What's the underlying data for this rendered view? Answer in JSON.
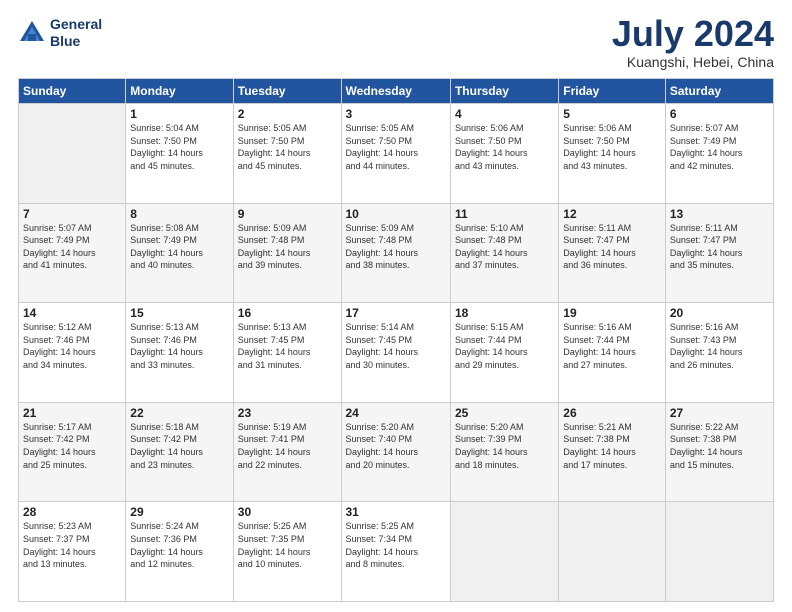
{
  "header": {
    "logo_line1": "General",
    "logo_line2": "Blue",
    "title": "July 2024",
    "location": "Kuangshi, Hebei, China"
  },
  "weekdays": [
    "Sunday",
    "Monday",
    "Tuesday",
    "Wednesday",
    "Thursday",
    "Friday",
    "Saturday"
  ],
  "weeks": [
    [
      {
        "day": "",
        "info": ""
      },
      {
        "day": "1",
        "info": "Sunrise: 5:04 AM\nSunset: 7:50 PM\nDaylight: 14 hours\nand 45 minutes."
      },
      {
        "day": "2",
        "info": "Sunrise: 5:05 AM\nSunset: 7:50 PM\nDaylight: 14 hours\nand 45 minutes."
      },
      {
        "day": "3",
        "info": "Sunrise: 5:05 AM\nSunset: 7:50 PM\nDaylight: 14 hours\nand 44 minutes."
      },
      {
        "day": "4",
        "info": "Sunrise: 5:06 AM\nSunset: 7:50 PM\nDaylight: 14 hours\nand 43 minutes."
      },
      {
        "day": "5",
        "info": "Sunrise: 5:06 AM\nSunset: 7:50 PM\nDaylight: 14 hours\nand 43 minutes."
      },
      {
        "day": "6",
        "info": "Sunrise: 5:07 AM\nSunset: 7:49 PM\nDaylight: 14 hours\nand 42 minutes."
      }
    ],
    [
      {
        "day": "7",
        "info": "Sunrise: 5:07 AM\nSunset: 7:49 PM\nDaylight: 14 hours\nand 41 minutes."
      },
      {
        "day": "8",
        "info": "Sunrise: 5:08 AM\nSunset: 7:49 PM\nDaylight: 14 hours\nand 40 minutes."
      },
      {
        "day": "9",
        "info": "Sunrise: 5:09 AM\nSunset: 7:48 PM\nDaylight: 14 hours\nand 39 minutes."
      },
      {
        "day": "10",
        "info": "Sunrise: 5:09 AM\nSunset: 7:48 PM\nDaylight: 14 hours\nand 38 minutes."
      },
      {
        "day": "11",
        "info": "Sunrise: 5:10 AM\nSunset: 7:48 PM\nDaylight: 14 hours\nand 37 minutes."
      },
      {
        "day": "12",
        "info": "Sunrise: 5:11 AM\nSunset: 7:47 PM\nDaylight: 14 hours\nand 36 minutes."
      },
      {
        "day": "13",
        "info": "Sunrise: 5:11 AM\nSunset: 7:47 PM\nDaylight: 14 hours\nand 35 minutes."
      }
    ],
    [
      {
        "day": "14",
        "info": "Sunrise: 5:12 AM\nSunset: 7:46 PM\nDaylight: 14 hours\nand 34 minutes."
      },
      {
        "day": "15",
        "info": "Sunrise: 5:13 AM\nSunset: 7:46 PM\nDaylight: 14 hours\nand 33 minutes."
      },
      {
        "day": "16",
        "info": "Sunrise: 5:13 AM\nSunset: 7:45 PM\nDaylight: 14 hours\nand 31 minutes."
      },
      {
        "day": "17",
        "info": "Sunrise: 5:14 AM\nSunset: 7:45 PM\nDaylight: 14 hours\nand 30 minutes."
      },
      {
        "day": "18",
        "info": "Sunrise: 5:15 AM\nSunset: 7:44 PM\nDaylight: 14 hours\nand 29 minutes."
      },
      {
        "day": "19",
        "info": "Sunrise: 5:16 AM\nSunset: 7:44 PM\nDaylight: 14 hours\nand 27 minutes."
      },
      {
        "day": "20",
        "info": "Sunrise: 5:16 AM\nSunset: 7:43 PM\nDaylight: 14 hours\nand 26 minutes."
      }
    ],
    [
      {
        "day": "21",
        "info": "Sunrise: 5:17 AM\nSunset: 7:42 PM\nDaylight: 14 hours\nand 25 minutes."
      },
      {
        "day": "22",
        "info": "Sunrise: 5:18 AM\nSunset: 7:42 PM\nDaylight: 14 hours\nand 23 minutes."
      },
      {
        "day": "23",
        "info": "Sunrise: 5:19 AM\nSunset: 7:41 PM\nDaylight: 14 hours\nand 22 minutes."
      },
      {
        "day": "24",
        "info": "Sunrise: 5:20 AM\nSunset: 7:40 PM\nDaylight: 14 hours\nand 20 minutes."
      },
      {
        "day": "25",
        "info": "Sunrise: 5:20 AM\nSunset: 7:39 PM\nDaylight: 14 hours\nand 18 minutes."
      },
      {
        "day": "26",
        "info": "Sunrise: 5:21 AM\nSunset: 7:38 PM\nDaylight: 14 hours\nand 17 minutes."
      },
      {
        "day": "27",
        "info": "Sunrise: 5:22 AM\nSunset: 7:38 PM\nDaylight: 14 hours\nand 15 minutes."
      }
    ],
    [
      {
        "day": "28",
        "info": "Sunrise: 5:23 AM\nSunset: 7:37 PM\nDaylight: 14 hours\nand 13 minutes."
      },
      {
        "day": "29",
        "info": "Sunrise: 5:24 AM\nSunset: 7:36 PM\nDaylight: 14 hours\nand 12 minutes."
      },
      {
        "day": "30",
        "info": "Sunrise: 5:25 AM\nSunset: 7:35 PM\nDaylight: 14 hours\nand 10 minutes."
      },
      {
        "day": "31",
        "info": "Sunrise: 5:25 AM\nSunset: 7:34 PM\nDaylight: 14 hours\nand 8 minutes."
      },
      {
        "day": "",
        "info": ""
      },
      {
        "day": "",
        "info": ""
      },
      {
        "day": "",
        "info": ""
      }
    ]
  ]
}
